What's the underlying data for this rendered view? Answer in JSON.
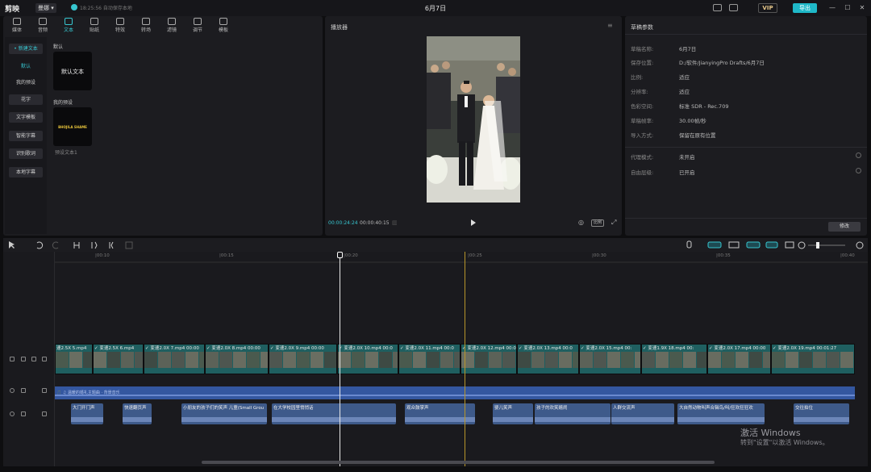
{
  "titlebar": {
    "app_name": "剪映",
    "user_menu": "曼娜 ▾",
    "save_status": "18:25:56 自动保存本地",
    "project_title": "6月7日",
    "vip_label": "VIP",
    "export_label": "导出",
    "win_min": "—",
    "win_max": "☐",
    "win_close": "✕"
  },
  "toolbar": {
    "items": [
      {
        "label": "媒体",
        "icon": "media-icon"
      },
      {
        "label": "音频",
        "icon": "audio-icon"
      },
      {
        "label": "文本",
        "icon": "text-icon"
      },
      {
        "label": "贴纸",
        "icon": "sticker-icon"
      },
      {
        "label": "特效",
        "icon": "effects-icon"
      },
      {
        "label": "转场",
        "icon": "transition-icon"
      },
      {
        "label": "滤镜",
        "icon": "filter-icon"
      },
      {
        "label": "调节",
        "icon": "adjust-icon"
      },
      {
        "label": "模板",
        "icon": "template-icon"
      }
    ],
    "active_index": 2,
    "ti_glyph": "TI"
  },
  "text_panel": {
    "nav": {
      "new_text": "• 新建文本",
      "default": "默认",
      "my_presets": "我的预设",
      "fancy": "花字",
      "text_template": "文字模板",
      "smart_caption": "智能字幕",
      "lyrics": "识别歌词",
      "local_caption": "本地字幕"
    },
    "default_section": "默认",
    "default_tile": "默认文本",
    "presets_section": "我的预设",
    "preset_tile_text": "BHOJILA SHAME",
    "preset_caption": "预设文本1"
  },
  "player": {
    "title": "播放器",
    "current_time": "00:00:24:24",
    "total_time": "00:00:40:15",
    "ratio_label": "比例",
    "menu_glyph": "≡",
    "fullscreen_glyph": "⤢",
    "screenshot_glyph": "◎",
    "grid_glyph": "▥"
  },
  "params": {
    "title": "草稿参数",
    "rows": [
      {
        "label": "草稿名称:",
        "value": "6月7日"
      },
      {
        "label": "保存位置:",
        "value": "D:/软件/JianyingPro Drafts/6月7日"
      },
      {
        "label": "比例:",
        "value": "适应"
      },
      {
        "label": "分辨率:",
        "value": "适应"
      },
      {
        "label": "色彩空间:",
        "value": "标准 SDR - Rec.709"
      },
      {
        "label": "草稿帧率:",
        "value": "30.00帧/秒"
      },
      {
        "label": "导入方式:",
        "value": "保留在原有位置"
      }
    ],
    "proxy_label": "代理模式:",
    "proxy_value": "未开启",
    "layer_label": "自由层级:",
    "layer_value": "已开启",
    "modify_label": "修改"
  },
  "timeline": {
    "ruler_ticks": [
      "|00:10",
      "|00:15",
      "|00:20",
      "|00:25",
      "|00:30",
      "|00:35",
      "|00:40"
    ],
    "clips": [
      "速2.5X 5.mp4",
      "✓ 变速2.5X 6.mp4",
      "✓ 变速2.0X 7.mp4 00:00",
      "✓ 变速2.0X 8.mp4 00:00",
      "✓ 变速2.0X 9.mp4 00:00",
      "✓ 变速2.0X 10.mp4 00:0",
      "✓ 变速2.0X 11.mp4 00:0",
      "✓ 变速2.0X 12.mp4 00:0",
      "✓ 变速2.0X 13.mp4 00:0",
      "✓ 变速2.0X 15.mp4 00:",
      "✓ 变速1.9X 18.mp4 00:",
      "✓ 变速2.0X 17.mp4 00:00",
      "✓ 变速2.0X 19.mp4 00:01:27"
    ],
    "music_label": "🎵 ♫ 温暖的婚礼主题曲 · 背景音乐",
    "audio_clips": [
      "大门开门声",
      "快速翻页声",
      "小朋友的孩子们的笑声 儿童(Small Grou",
      "在大学校园里悄悄话",
      "观众鼓掌声",
      "婴儿笑声",
      "孩子的欢笑嬉闹",
      "人群交流声",
      "大自然动物叫声合辑鸟/叫/狂欢狂狂欢",
      "交往拍位"
    ]
  },
  "watermark": {
    "title": "激活 Windows",
    "subtitle": "转到\"设置\"以激活 Windows。"
  }
}
